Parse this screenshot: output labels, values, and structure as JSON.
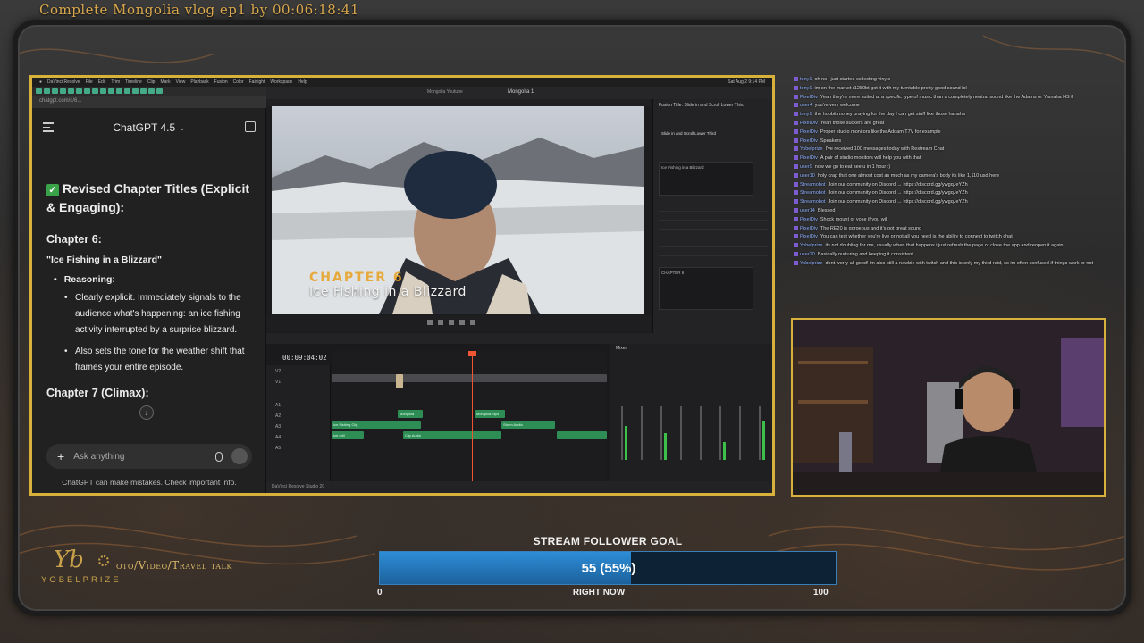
{
  "stream": {
    "title": "Complete Mongolia vlog ep1 by 00:06:18:41"
  },
  "mac": {
    "menu": [
      "DaVinci Resolve",
      "File",
      "Edit",
      "Trim",
      "Timeline",
      "Clip",
      "Mark",
      "View",
      "Playback",
      "Fusion",
      "Color",
      "Fairlight",
      "Workspace",
      "Help"
    ],
    "clock": "Sat Aug 2 9:14 PM"
  },
  "browser": {
    "url": "chatgpt.com/c/6..."
  },
  "chatgpt": {
    "model": "ChatGPT 4.5",
    "heading": "Revised Chapter Titles (Explicit & Engaging):",
    "chapter6": "Chapter 6:",
    "quote": "\"Ice Fishing in a Blizzard\"",
    "reasoning": "Reasoning:",
    "bullet1": "Clearly explicit. Immediately signals to the audience what's happening: an ice fishing activity interrupted by a surprise blizzard.",
    "bullet2": "Also sets the tone for the weather shift that frames your entire episode.",
    "chapter7": "Chapter 7 (Climax):",
    "ask_placeholder": "Ask anything",
    "disclaimer": "ChatGPT can make mistakes. Check important info.",
    "icons": [
      "menu-icon",
      "edit-icon",
      "plus-icon",
      "mic-icon",
      "voice-icon",
      "scroll-down-icon"
    ]
  },
  "resolve": {
    "project": "Mongolia 1",
    "tab_label": "Mongolia Youtube",
    "lower_third_chapter": "CHAPTER 6",
    "lower_third_title": "Ice Fishing in a Blizzard",
    "inspector_title": "Fusion Title: Slide in and Scroll Lower Third",
    "inspector_sub": "Slide in and Scroll Lower Third",
    "inspector_text": "Ice Fishing in a Blizzard",
    "inspector_text2": "CHAPTER 6",
    "timecode": "00:09:04:02",
    "tracks": [
      "V2",
      "V1",
      "A1",
      "A2",
      "A3",
      "A4",
      "A5"
    ],
    "clips": [
      "Mongolia",
      "Mongolia.mp4",
      "Ice Fishing Clip",
      "Storm Audio",
      "Clip Audio",
      "Ice drill"
    ],
    "mixer_label": "Mixer",
    "bottom_label": "DaVinci Resolve Studio 20"
  },
  "twitch_chat": [
    {
      "user": "tony1",
      "text": "oh no i just started collecting vinyls"
    },
    {
      "user": "tony1",
      "text": "im on the market r1280bt got it with my turntable pretty good sound lol"
    },
    {
      "user": "PixelDiv",
      "text": "Yeah they're more suited at a specific type of music than a completely neutral sound like the Adams or Yamaha HS 8"
    },
    {
      "user": "user4",
      "text": "you're very welcome"
    },
    {
      "user": "tony1",
      "text": "the hobbit money praying for the day I can get stuff like those hahaha"
    },
    {
      "user": "PixelDiv",
      "text": "Yeah those suckers are great"
    },
    {
      "user": "PixelDiv",
      "text": "Proper studio monitors like the Addam T7V for example"
    },
    {
      "user": "PixelDiv",
      "text": "Speakers"
    },
    {
      "user": "Yobelprize",
      "text": "I've received 100 messages today with Restream Chat"
    },
    {
      "user": "PixelDiv",
      "text": "A pair of studio monitors will help you with that"
    },
    {
      "user": "user9",
      "text": "now we go to eat see u in 1 hour :)"
    },
    {
      "user": "user10",
      "text": "holy crap that one almost cost as much as my camera's body its like 1,110 usd here"
    },
    {
      "user": "Streamobot",
      "text": "Join our community on Discord → https://discord.gg/ywgqJeYZh"
    },
    {
      "user": "Streamobot",
      "text": "Join our community on Discord → https://discord.gg/ywgqJeYZh"
    },
    {
      "user": "Streamobot",
      "text": "Join our community on Discord → https://discord.gg/ywgqJeYZh"
    },
    {
      "user": "user14",
      "text": "Blessed"
    },
    {
      "user": "PixelDiv",
      "text": "Shock mount or yoke if you will"
    },
    {
      "user": "PixelDiv",
      "text": "The RE20 is gorgeous and it's got great sound"
    },
    {
      "user": "PixelDiv",
      "text": "You can test whether you're live or not all you need is the ability to connect to twitch chat"
    },
    {
      "user": "Yobelprize",
      "text": "its not doubling for me, usually when that happens i just refresh the page or close the app and reopen it again"
    },
    {
      "user": "user20",
      "text": "Basically nurturing and keeping it consistent"
    },
    {
      "user": "Yobelprize",
      "text": "dont worry all good! im also still a newbie with twitch and this is only my third raid, so im often confused if things work or not"
    }
  ],
  "brand": {
    "logo": "Yb",
    "name": "YOBELPRIZE",
    "tagline": "oto/Video/Travel talk"
  },
  "goal": {
    "title": "STREAM FOLLOWER GOAL",
    "value_label": "55 (55%)",
    "fraction": 0.55,
    "min": "0",
    "max": "100",
    "now": "RIGHT NOW"
  }
}
